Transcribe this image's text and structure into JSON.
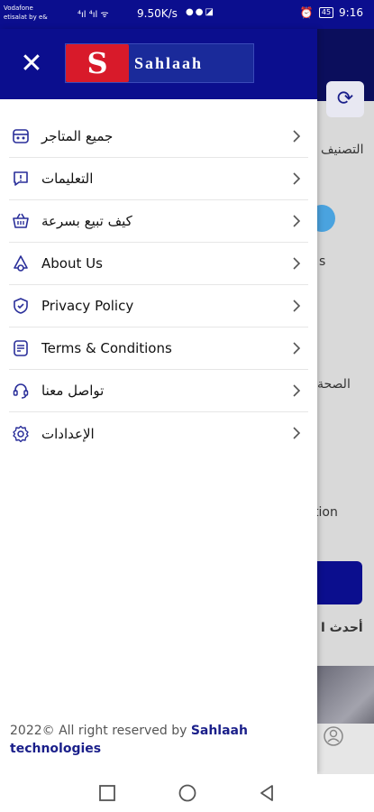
{
  "status_bar": {
    "carrier_line1": "Vodafone",
    "carrier_line2": "etisalat by e&",
    "speed": "9.50K/s",
    "battery": "45",
    "time": "9:16"
  },
  "background_app": {
    "text1": "التصنيف",
    "text2": "s",
    "text3": "الصحة",
    "text4": "tion",
    "text5": "أحدث ا",
    "nav_label": "حساب"
  },
  "drawer": {
    "logo_letter": "S",
    "logo_text": "Sahlaah",
    "menu": [
      {
        "label": "جميع المتاجر",
        "icon": "store-icon"
      },
      {
        "label": "التعليمات",
        "icon": "info-message-icon"
      },
      {
        "label": "كيف تبيع بسرعة",
        "icon": "basket-icon"
      },
      {
        "label": "About Us",
        "icon": "about-icon"
      },
      {
        "label": "Privacy Policy",
        "icon": "shield-icon"
      },
      {
        "label": "Terms & Conditions",
        "icon": "document-icon"
      },
      {
        "label": "تواصل معنا",
        "icon": "support-icon"
      },
      {
        "label": "الإعدادات",
        "icon": "settings-icon"
      }
    ],
    "footer_prefix": "2022© All right reserved by ",
    "footer_brand_line1": "Sahlaah",
    "footer_brand_line2": "technologies"
  },
  "colors": {
    "primary": "#0b0e8e",
    "logo_red": "#d81a2a",
    "icon_blue": "#2a2f9a"
  }
}
